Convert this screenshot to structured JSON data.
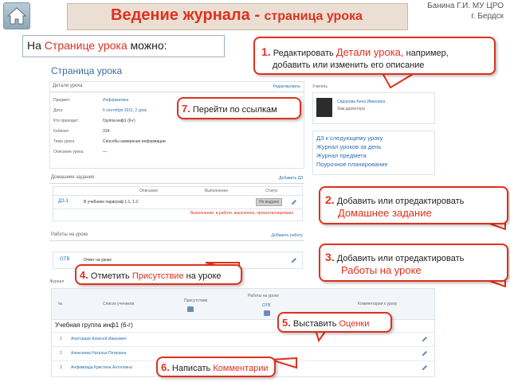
{
  "header": {
    "title_main": "Ведение журнала - ",
    "title_sub": "страница урока",
    "author_line1": "Банина Г.И. МУ ЦРО",
    "author_line2": "г. Бердск"
  },
  "intro": {
    "before": "На ",
    "highlight": "Странице урока",
    "after": " можно:"
  },
  "mock": {
    "page_title": "Страница урока",
    "details": {
      "heading": "Детали урока",
      "edit_link": "Редактировать",
      "rows": [
        {
          "label": "Предмет:",
          "value": "Информатика"
        },
        {
          "label": "Дата:",
          "value": "6 сентября 2011, 2 урок"
        },
        {
          "label": "Кто приходит:",
          "value": "Группа инф1 (6-г)"
        },
        {
          "label": "Кабинет:",
          "value": "314"
        },
        {
          "label": "Тема урока",
          "value": "Способы измерения информации"
        },
        {
          "label": "Описание урока",
          "value": "—"
        }
      ]
    },
    "teacher": {
      "heading": "Учитель",
      "name": "Сидорова Анна Ивановна",
      "role": "Зам.директора"
    },
    "links": [
      "ДЗ к следующему уроку",
      "Журнал уроков за день",
      "Журнал предмета",
      "Поурочное планирование"
    ],
    "homework": {
      "heading": "Домашние задания",
      "add_link": "Добавить ДЗ",
      "col_desc": "Описание",
      "col_done": "Выполнение",
      "col_status": "Статус",
      "row_code": "ДЗ-1",
      "row_text": "В учебнике параграф 1.1, 1.2",
      "row_status": "Не выдано",
      "progress": "Выполнение: в работе, выполнено, проконтролировано"
    },
    "works": {
      "heading": "Работы на уроке",
      "add_link": "Добавить работу",
      "row_code": "ОТВ",
      "row_text": "Ответ на уроке"
    },
    "journal": {
      "heading": "Журнал",
      "col_num": "№",
      "col_students": "Список учеников",
      "col_attendance": "Присутствие",
      "col_works": "Работы на уроке",
      "col_works_sub": "ОТВ",
      "col_comments": "Комментарии к уроку",
      "group": "Учебная группа инф1 (6-г)",
      "students": [
        {
          "n": "1",
          "name": "Апаторцев Алексей Иванович"
        },
        {
          "n": "2",
          "name": "Алексеева Наталья Петровна"
        },
        {
          "n": "3",
          "name": "Анфимовда Кристина Антоновна"
        }
      ]
    }
  },
  "callouts": {
    "c1": {
      "num": "1.",
      "pre": " Редактировать ",
      "hl": "Детали урока,",
      "post": " например,",
      "line2": "добавить или изменить его описание"
    },
    "c2": {
      "num": "2.",
      "pre": " Добавить или отредактировать",
      "hl": "Домашнее задание"
    },
    "c3": {
      "num": "3.",
      "pre": " Добавить или отредактировать",
      "hl": "Работы на уроке"
    },
    "c4": {
      "num": "4.",
      "pre": " Отметить ",
      "hl": "Присутствие",
      "post": " на уроке"
    },
    "c5": {
      "num": "5.",
      "pre": " Выставить ",
      "hl": "Оценки"
    },
    "c6": {
      "num": "6.",
      "pre": " Написать ",
      "hl": "Комментарии"
    },
    "c7": {
      "num": "7.",
      "pre": " Перейти по ссылкам"
    }
  },
  "colors": {
    "accent": "#e0301e",
    "link": "#2a6fb0",
    "title_bg": "#eadfd2"
  },
  "icons": {
    "home": "home-icon",
    "edit": "pencil-icon"
  }
}
